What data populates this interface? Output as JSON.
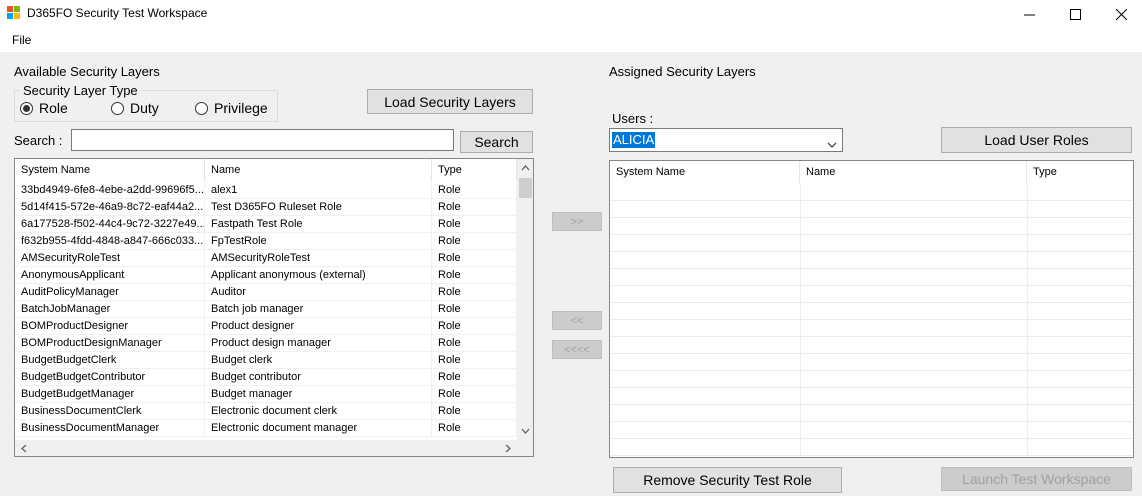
{
  "window": {
    "title": "D365FO Security Test Workspace",
    "controls": {
      "minimize": "—",
      "maximize": "☐",
      "close": "✕"
    }
  },
  "menu": {
    "file": "File"
  },
  "left": {
    "heading": "Available Security Layers",
    "layer_type": {
      "legend": "Security Layer Type",
      "options": [
        {
          "label": "Role",
          "selected": true
        },
        {
          "label": "Duty",
          "selected": false
        },
        {
          "label": "Privilege",
          "selected": false
        }
      ]
    },
    "load_button": "Load Security Layers",
    "search_label": "Search :",
    "search_value": "",
    "search_button": "Search",
    "columns": [
      "System Name",
      "Name",
      "Type"
    ],
    "rows": [
      [
        "33bd4949-6fe8-4ebe-a2dd-99696f5...",
        "alex1",
        "Role"
      ],
      [
        "5d14f415-572e-46a9-8c72-eaf44a2...",
        "Test D365FO Ruleset Role",
        "Role"
      ],
      [
        "6a177528-f502-44c4-9c72-3227e49...",
        "Fastpath Test Role",
        "Role"
      ],
      [
        "f632b955-4fdd-4848-a847-666c033...",
        "FpTestRole",
        "Role"
      ],
      [
        "AMSecurityRoleTest",
        "AMSecurityRoleTest",
        "Role"
      ],
      [
        "AnonymousApplicant",
        "Applicant anonymous (external)",
        "Role"
      ],
      [
        "AuditPolicyManager",
        "Auditor",
        "Role"
      ],
      [
        "BatchJobManager",
        "Batch job manager",
        "Role"
      ],
      [
        "BOMProductDesigner",
        "Product designer",
        "Role"
      ],
      [
        "BOMProductDesignManager",
        "Product design manager",
        "Role"
      ],
      [
        "BudgetBudgetClerk",
        "Budget clerk",
        "Role"
      ],
      [
        "BudgetBudgetContributor",
        "Budget contributor",
        "Role"
      ],
      [
        "BudgetBudgetManager",
        "Budget manager",
        "Role"
      ],
      [
        "BusinessDocumentClerk",
        "Electronic document clerk",
        "Role"
      ],
      [
        "BusinessDocumentManager",
        "Electronic document manager",
        "Role"
      ]
    ]
  },
  "transfer": {
    "add": ">>",
    "remove": "<<",
    "remove_all": "<<<<"
  },
  "right": {
    "heading": "Assigned Security Layers",
    "users_label": "Users :",
    "selected_user": "ALICIA",
    "load_button": "Load User Roles",
    "columns": [
      "System Name",
      "Name",
      "Type"
    ],
    "remove_button": "Remove Security Test Role",
    "launch_button": "Launch Test Workspace"
  },
  "colors": {
    "selection": "#0078d7",
    "app_icon": [
      "#f25022",
      "#7fba00",
      "#00a4ef",
      "#ffb900"
    ]
  }
}
